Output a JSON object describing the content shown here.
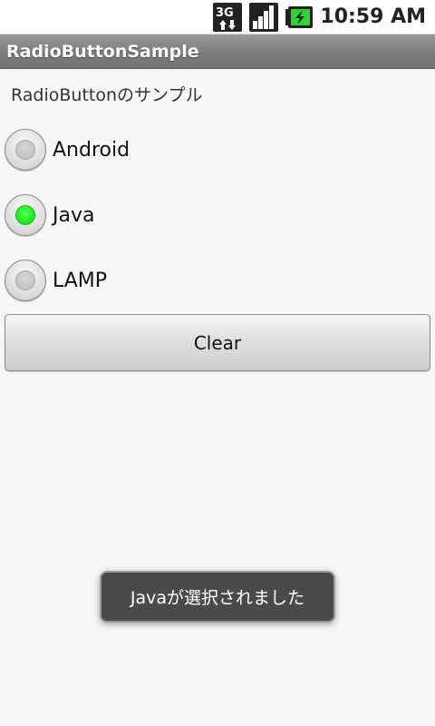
{
  "status_bar": {
    "network_type": "3G",
    "time": "10:59 AM",
    "battery_color": "#2ed52e"
  },
  "app": {
    "title": "RadioButtonSample",
    "description": "RadioButtonのサンプル"
  },
  "radio_group": {
    "options": [
      {
        "label": "Android",
        "checked": false
      },
      {
        "label": "Java",
        "checked": true
      },
      {
        "label": "LAMP",
        "checked": false
      }
    ],
    "checked_color": "#00e600"
  },
  "clear_button": {
    "label": "Clear"
  },
  "toast": {
    "message": "Javaが選択されました"
  }
}
